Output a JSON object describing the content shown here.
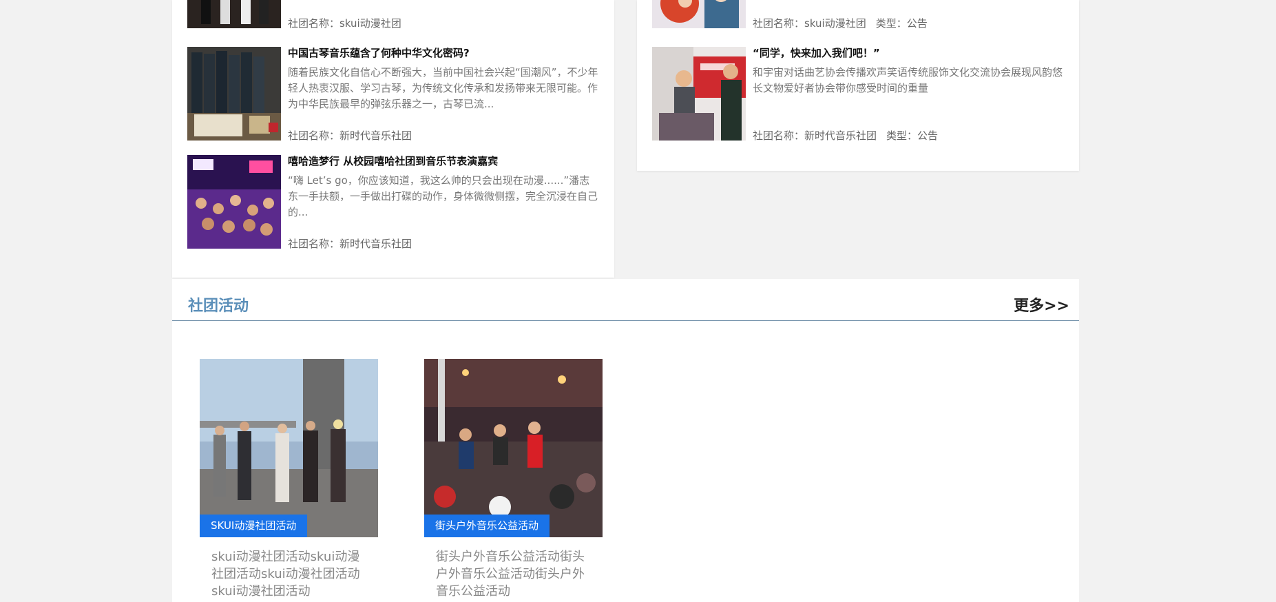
{
  "news_left": [
    {
      "title": "",
      "desc": "",
      "meta": [
        "社团名称：skui动漫社团"
      ]
    },
    {
      "title": "中国古琴音乐蕴含了何种中华文化密码?",
      "desc": "随着民族文化自信心不断强大，当前中国社会兴起“国潮风”，不少年轻人热衷汉服、学习古琴，为传统文化传承和发扬带来无限可能。作为中华民族最早的弹弦乐器之一，古琴已流...",
      "meta": [
        "社团名称：新时代音乐社团"
      ]
    },
    {
      "title": "嘻哈造梦行 从校园嘻哈社团到音乐节表演嘉宾",
      "desc": "“嗨 Let’s go，你应该知道，我这么帅的只会出现在动漫......”潘志东一手扶额，一手做出打碟的动作，身体微微侧摆，完全沉浸在自己的...",
      "meta": [
        "社团名称：新时代音乐社团"
      ]
    }
  ],
  "news_right": [
    {
      "title": "",
      "desc": "",
      "meta": [
        "社团名称：skui动漫社团",
        "类型：公告"
      ]
    },
    {
      "title": "“同学，快来加入我们吧！”",
      "desc": "和宇宙对话曲艺协会传播欢声笑语传统服饰文化交流协会展现风韵悠长文物爱好者协会带你感受时间的重量",
      "meta": [
        "社团名称：新时代音乐社团",
        "类型：公告"
      ]
    }
  ],
  "activities": {
    "title": "社团活动",
    "more": "更多>>",
    "cards": [
      {
        "tag": "SKUI动漫社团活动",
        "desc": "skui动漫社团活动skui动漫社团活动skui动漫社团活动skui动漫社团活动"
      },
      {
        "tag": "街头户外音乐公益活动",
        "desc": "街头户外音乐公益活动街头户外音乐公益活动街头户外音乐公益活动"
      }
    ]
  },
  "colors": {
    "background": "#f2f2f2",
    "section_title": "#5b8fb9",
    "tag_bg": "#1a73e8"
  }
}
